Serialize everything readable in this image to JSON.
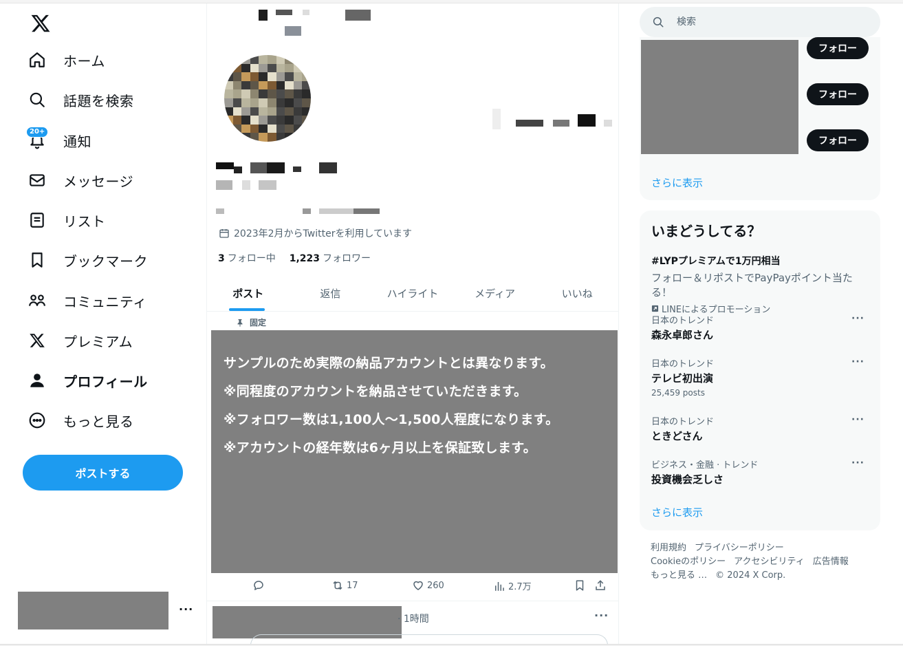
{
  "sidebar": {
    "items": [
      {
        "label": "ホーム",
        "icon": "home-icon"
      },
      {
        "label": "話題を検索",
        "icon": "search-icon"
      },
      {
        "label": "通知",
        "icon": "bell-icon",
        "badge": "20+"
      },
      {
        "label": "メッセージ",
        "icon": "mail-icon"
      },
      {
        "label": "リスト",
        "icon": "list-icon"
      },
      {
        "label": "ブックマーク",
        "icon": "bookmark-icon"
      },
      {
        "label": "コミュニティ",
        "icon": "community-icon"
      },
      {
        "label": "プレミアム",
        "icon": "x-logo-icon"
      },
      {
        "label": "プロフィール",
        "icon": "person-icon",
        "active": true
      },
      {
        "label": "もっと見る",
        "icon": "more-circle-icon"
      }
    ],
    "post_button": "ポストする",
    "account_more": "···"
  },
  "profile": {
    "joined": "2023年2月からTwitterを利用しています",
    "following_count": "3",
    "following_label": "フォロー中",
    "followers_count": "1,223",
    "followers_label": "フォロワー"
  },
  "tabs": [
    {
      "label": "ポスト",
      "active": true
    },
    {
      "label": "返信"
    },
    {
      "label": "ハイライト"
    },
    {
      "label": "メディア"
    },
    {
      "label": "いいね"
    }
  ],
  "pinned_post": {
    "pinned_label": "固定",
    "lines": [
      "サンプルのため実際の納品アカウントとは異なります。",
      "※同程度のアカウントを納品させていただきます。",
      "※フォロワー数は1,100人～1,500人程度になります。",
      "※アカウントの経年数は6ヶ月以上を保証致します。"
    ],
    "retweets": "17",
    "likes": "260",
    "views": "2.7万"
  },
  "next_post": {
    "time": "· 1時間",
    "more": "···"
  },
  "search": {
    "placeholder": "検索"
  },
  "who_to_follow": {
    "follow_label": "フォロー",
    "show_more": "さらに表示"
  },
  "trends": {
    "title": "いまどうしてる？",
    "promo": {
      "name": "#LYPプレミアムで1万円相当",
      "desc": "フォロー＆リポストでPayPayポイント当たる！",
      "by": "LINEによるプロモーション"
    },
    "items": [
      {
        "meta": "日本のトレンド",
        "name": "森永卓郎さん",
        "sub": ""
      },
      {
        "meta": "日本のトレンド",
        "name": "テレビ初出演",
        "sub": "25,459 posts"
      },
      {
        "meta": "日本のトレンド",
        "name": "ときどさん",
        "sub": ""
      },
      {
        "meta": "ビジネス・金融 · トレンド",
        "name": "投資機会乏しさ",
        "sub": ""
      }
    ],
    "more_label": "···",
    "show_more": "さらに表示"
  },
  "footer": {
    "links": [
      "利用規約",
      "プライバシーポリシー",
      "Cookieのポリシー",
      "アクセシビリティ",
      "広告情報",
      "もっと見る …"
    ],
    "copyright": "© 2024 X Corp."
  },
  "colors": {
    "accent": "#1d9bf0",
    "text": "#0f1419",
    "muted": "#536471",
    "redacted": "#808080"
  }
}
